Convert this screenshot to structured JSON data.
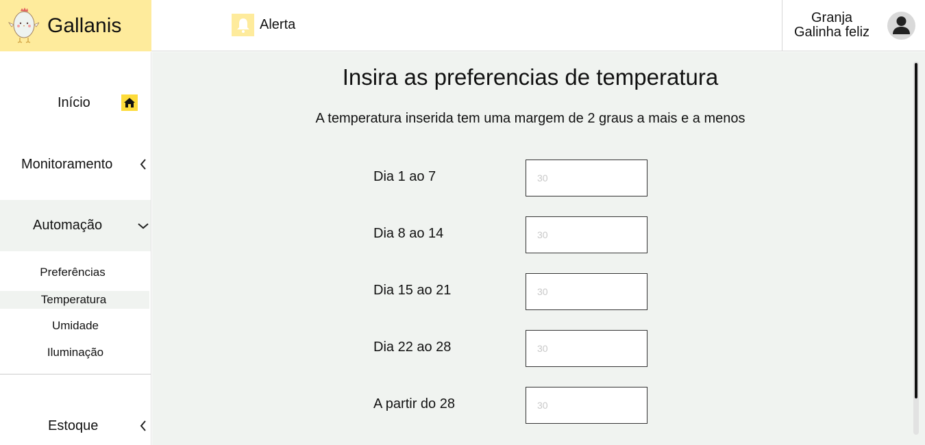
{
  "brand": {
    "name": "Gallanis"
  },
  "header": {
    "alert_label": "Alerta",
    "user_line1": "Granja",
    "user_line2": "Galinha feliz"
  },
  "sidebar": {
    "inicio": "Início",
    "monitoramento": "Monitoramento",
    "automacao": "Automação",
    "sub_items": [
      "Preferências",
      "Temperatura",
      "Umidade",
      "Iluminação"
    ],
    "estoque": "Estoque"
  },
  "main": {
    "title": "Insira as preferencias de temperatura",
    "subtitle": "A temperatura inserida tem uma margem de 2 graus a mais e a menos",
    "rows": [
      {
        "label": "Dia  1 ao 7",
        "placeholder": "30"
      },
      {
        "label": "Dia  8 ao 14",
        "placeholder": "30"
      },
      {
        "label": "Dia  15 ao 21",
        "placeholder": "30"
      },
      {
        "label": "Dia  22 ao 28",
        "placeholder": "30"
      },
      {
        "label": "A partir do 28",
        "placeholder": "30"
      }
    ]
  },
  "colors": {
    "brand_yellow": "#feeb9c",
    "main_bg": "#f0f3f0"
  }
}
